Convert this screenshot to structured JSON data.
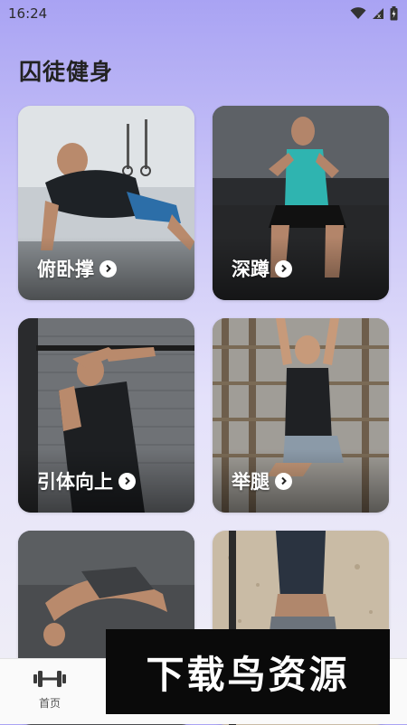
{
  "status_bar": {
    "time": "16:24"
  },
  "header": {
    "title": "囚徒健身"
  },
  "cards": [
    {
      "label": "俯卧撑"
    },
    {
      "label": "深蹲"
    },
    {
      "label": "引体向上"
    },
    {
      "label": "举腿"
    },
    {
      "label": ""
    },
    {
      "label": ""
    }
  ],
  "tabbar": {
    "home_label": "首页"
  },
  "watermark": {
    "text": "下载鸟资源"
  },
  "colors": {
    "accent": "#a9a3f3",
    "background": "#f1f0f6"
  }
}
